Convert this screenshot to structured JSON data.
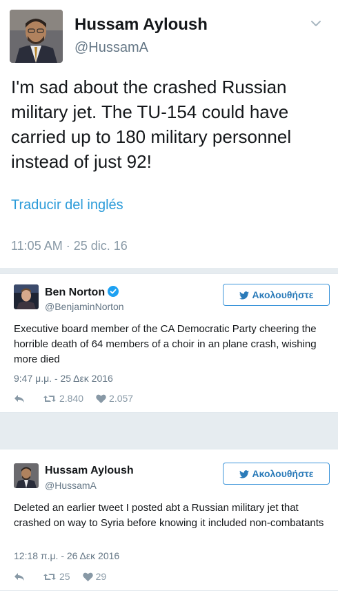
{
  "main_tweet": {
    "name": "Hussam Ayloush",
    "handle": "@HussamA",
    "text": "I'm sad about the crashed Russian military jet. The TU-154 could have carried up to 180 military personnel instead of just 92!",
    "translate_link": "Traducir del inglés",
    "timestamp": "11:05 AM · 25 dic. 16"
  },
  "card_1": {
    "name": "Ben Norton",
    "verified": true,
    "handle": "@BenjaminNorton",
    "follow_label": "Ακολουθήστε",
    "text": "Executive board member of the CA Democratic Party cheering the horrible death of 64 members of a choir in an plane crash, wishing more died",
    "timestamp": "9:47 μ.μ. - 25 Δεκ 2016",
    "retweets": "2.840",
    "likes": "2.057"
  },
  "card_2": {
    "name": "Hussam Ayloush",
    "handle": "@HussamA",
    "follow_label": "Ακολουθήστε",
    "text": "Deleted an earlier tweet I posted abt a Russian military jet that crashed on way to Syria before knowing it included non-combatants",
    "timestamp": "12:18 π.μ. - 26 Δεκ 2016",
    "retweets": "25",
    "likes": "29"
  },
  "colors": {
    "link_blue": "#2b9bd9",
    "follow_blue": "#2b7bb9",
    "verified_blue": "#1da1f2",
    "muted": "#8899a6",
    "separator": "#e6ecf0"
  },
  "icons": [
    "chevron-down-icon",
    "verified-icon",
    "twitter-bird-icon",
    "reply-icon",
    "retweet-icon",
    "heart-icon"
  ]
}
